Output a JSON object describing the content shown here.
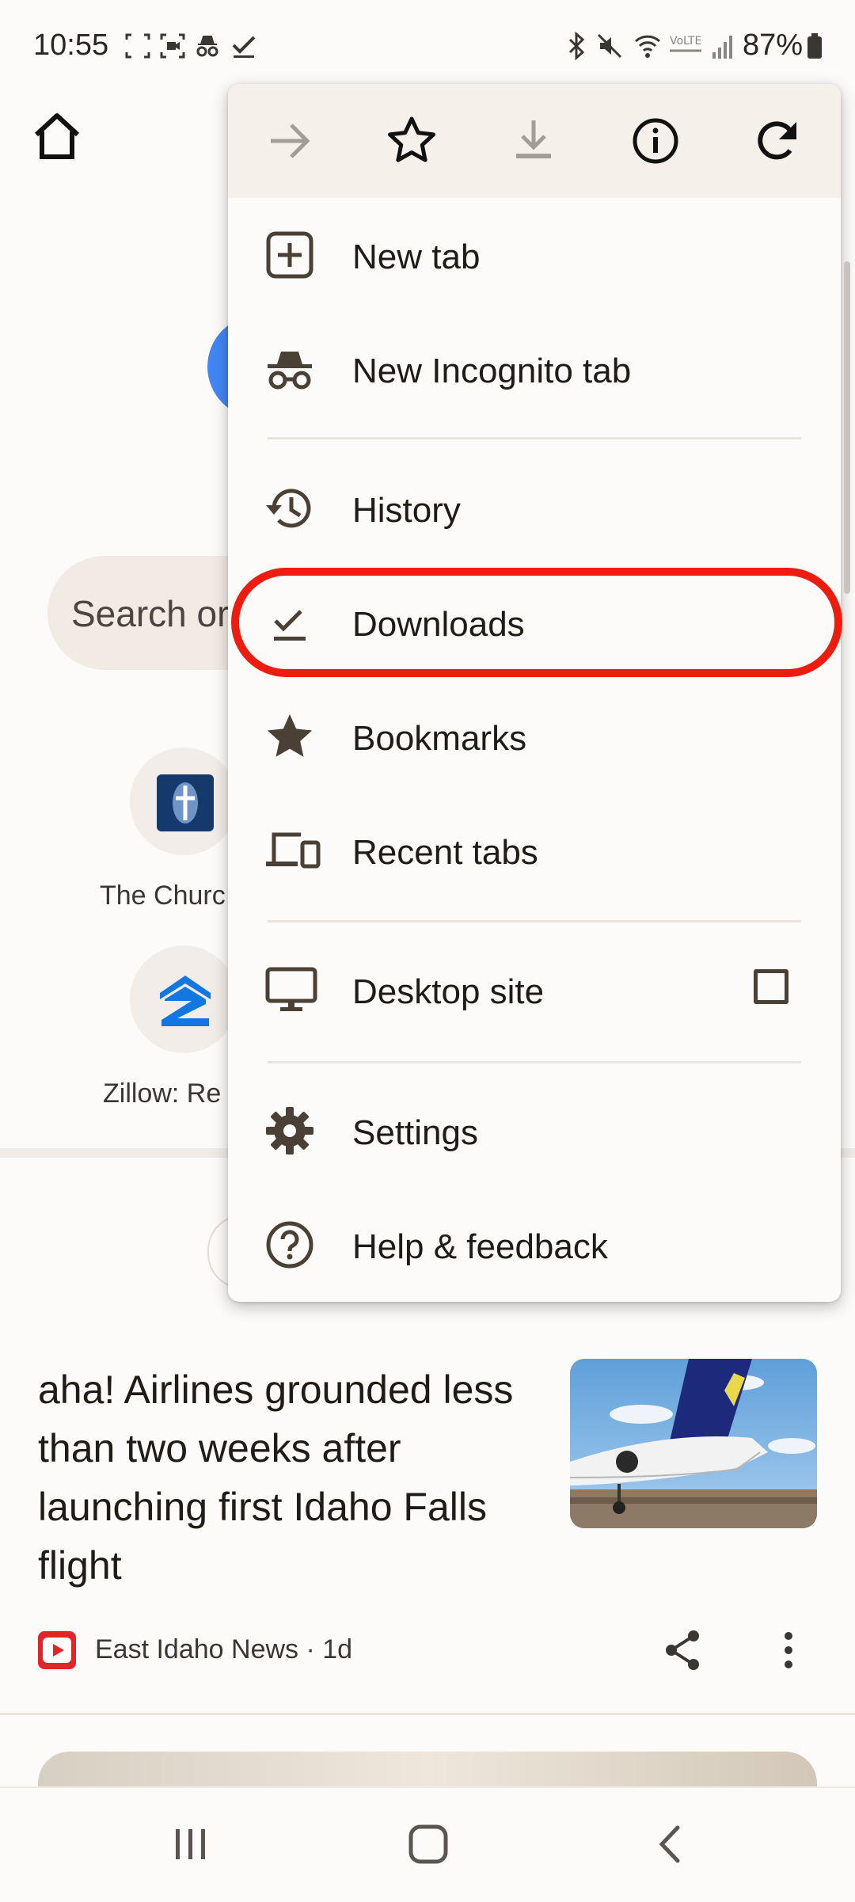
{
  "status_bar": {
    "time": "10:55",
    "battery": "87%"
  },
  "page": {
    "search_placeholder": "Search or",
    "shortcuts": [
      {
        "label": "The Churc"
      },
      {
        "label": "Zillow: Re"
      }
    ],
    "news": {
      "title": "aha! Airlines grounded less than two weeks after launching first Idaho Falls flight",
      "source": "East Idaho News · 1d"
    }
  },
  "menu": {
    "toolbar": [
      "forward-icon",
      "bookmark-star-icon",
      "download-icon",
      "info-icon",
      "reload-icon"
    ],
    "items": [
      {
        "label": "New tab",
        "icon": "new-tab-icon"
      },
      {
        "label": "New Incognito tab",
        "icon": "incognito-icon"
      },
      {
        "label": "History",
        "icon": "history-icon"
      },
      {
        "label": "Downloads",
        "icon": "downloads-check-icon"
      },
      {
        "label": "Bookmarks",
        "icon": "star-icon"
      },
      {
        "label": "Recent tabs",
        "icon": "devices-icon"
      },
      {
        "label": "Desktop site",
        "icon": "monitor-icon",
        "checked": false
      },
      {
        "label": "Settings",
        "icon": "gear-icon"
      },
      {
        "label": "Help & feedback",
        "icon": "help-icon"
      }
    ]
  },
  "colors": {
    "highlight": "#ee1c0e",
    "accent_blue": "#4285f4"
  }
}
